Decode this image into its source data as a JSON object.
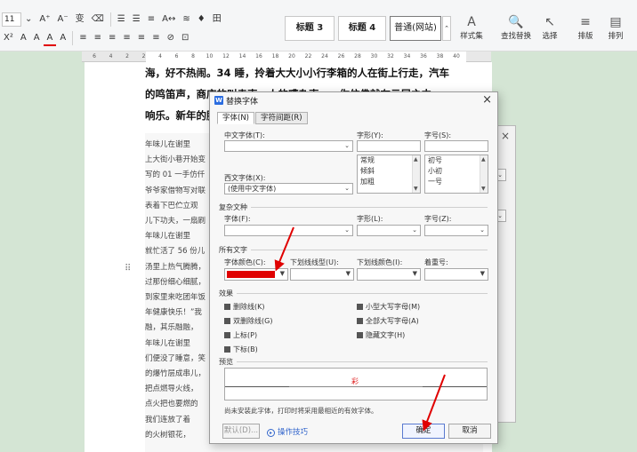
{
  "toolbar": {
    "font_size": "11",
    "row1": [
      "A⁺",
      "A⁻",
      "变",
      "⌫",
      "☰",
      "☰",
      "≡",
      "A↔",
      "≋",
      "♦",
      "田"
    ],
    "row2": [
      "X²",
      "A",
      "A",
      "A",
      "A",
      "≡",
      "≡",
      "≡",
      "≡",
      "≡",
      "≡",
      "⊘",
      "⊡"
    ],
    "styles": [
      "标题 3",
      "标题 4",
      "普通(网站)"
    ],
    "tools": [
      {
        "icon": "A",
        "label": "样式集"
      },
      {
        "icon": "🔍",
        "label": "查找替换"
      },
      {
        "icon": "↖",
        "label": "选择"
      },
      {
        "icon": "≡",
        "label": "排版"
      },
      {
        "icon": "▤",
        "label": "排列"
      }
    ]
  },
  "ruler": {
    "labels": [
      "6",
      "4",
      "2",
      "2",
      "4",
      "6",
      "8",
      "10",
      "12",
      "14",
      "16",
      "18",
      "20",
      "22",
      "24",
      "26",
      "28",
      "30",
      "32",
      "34",
      "36",
      "38",
      "40"
    ]
  },
  "document": {
    "lines": [
      "海，好不热闹。34 睡，拎着大大小小行李箱的人在街上行走，汽车",
      "的鸣笛声，商店的叫卖声，人的嘈杂声……你仿佛就在云层之中。",
      "响乐。新年的脚步"
    ],
    "small_lines": [
      "年味儿在谢里",
      "上大街小巷开始变",
      "写的 01 一手仿仟",
      "爷爷家借物写对联",
      "表着下巴伫立观",
      "儿下功夫，一扇刷",
      "年味儿在谢里",
      "就忙活了 56 份儿",
      "汤里上热气腾腾，",
      "过那份细心细腻，",
      "到家里来吃团年饭",
      "年健康快乐！”我",
      "融，其乐融融，",
      "年味儿在谢里",
      "们便没了睡意，笑",
      "的爆竹层成串儿，",
      "把点燃导火线，",
      "点火把也要燃的",
      "我们连放了着",
      "的火树银花，"
    ]
  },
  "dialog": {
    "title": "替换字体",
    "close": "×",
    "tabs": [
      "字体(N)",
      "字符间距(R)"
    ],
    "cn_font_label": "中文字体(T):",
    "style_label": "字形(Y):",
    "size_label": "字号(S):",
    "western_font_label": "西文字体(X):",
    "western_font_value": "(使用中文字体)",
    "style_options": [
      "常规",
      "倾斜",
      "加粗"
    ],
    "size_options": [
      "初号",
      "小初",
      "一号"
    ],
    "complex_section": "复杂文种",
    "complex_font_label": "字体(F):",
    "complex_style_label": "字形(L):",
    "complex_size_label": "字号(Z):",
    "all_text_section": "所有文字",
    "font_color_label": "字体颜色(C):",
    "underline_label": "下划线线型(U):",
    "underline_color_label": "下划线颜色(I):",
    "emphasis_label": "着重号:",
    "effects_section": "效果",
    "effects_left": [
      "删除线(K)",
      "双删除线(G)",
      "上标(P)",
      "下标(B)"
    ],
    "effects_right": [
      "小型大写字母(M)",
      "全部大写字母(A)",
      "隐藏文字(H)"
    ],
    "preview_section": "预览",
    "preview_text": "彩",
    "note": "尚未安装此字体，打印时将采用最相近的有效字体。",
    "default_button": "默认(D)...",
    "tips_link": "操作技巧",
    "ok_button": "确定",
    "cancel_button": "取消"
  },
  "colors": {
    "font_color": "#e00000",
    "arrow": "#e00000",
    "page_bg": "#d4e5d4"
  }
}
